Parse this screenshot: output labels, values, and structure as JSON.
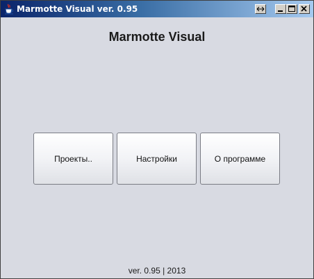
{
  "window": {
    "title": "Marmotte Visual ver. 0.95",
    "controls": {
      "resize_icon": "horizontal-resize-icon",
      "minimize_icon": "minimize-icon",
      "maximize_icon": "maximize-icon",
      "close_icon": "close-icon"
    },
    "app_icon": "java-cup-icon",
    "background_color": "#d8dae2",
    "titlebar_color_start": "#0a246a",
    "titlebar_color_end": "#a6caf0"
  },
  "main": {
    "heading": "Marmotte Visual",
    "buttons": [
      {
        "label": "Проекты.."
      },
      {
        "label": "Настройки"
      },
      {
        "label": "О программе"
      }
    ]
  },
  "footer": {
    "version_text": "ver. 0.95 | 2013"
  }
}
